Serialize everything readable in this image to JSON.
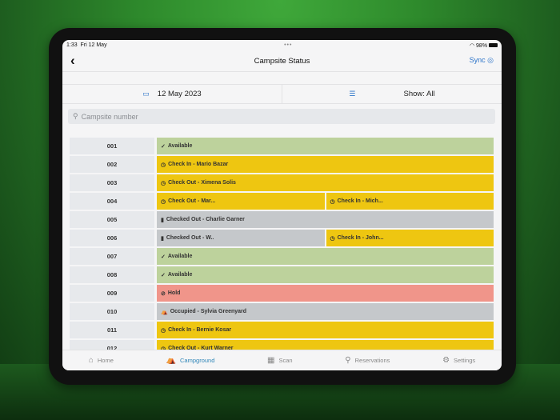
{
  "status_bar": {
    "time": "1:33",
    "date": "Fri 12 May",
    "battery": "98%"
  },
  "nav": {
    "title": "Campsite Status",
    "sync_label": "Sync"
  },
  "filters": {
    "date": "12 May 2023",
    "show": "Show: All"
  },
  "search": {
    "placeholder": "Campsite number"
  },
  "colors": {
    "available": "#bdd29c",
    "pending": "#eec611",
    "checked_out": "#c5c8cb",
    "hold": "#f0958a",
    "occupied": "#c5c8cb",
    "accent": "#2c74c9"
  },
  "sites": [
    {
      "number": "001",
      "cells": [
        {
          "status": "available",
          "icon": "check-icon",
          "label": "Available"
        }
      ]
    },
    {
      "number": "002",
      "cells": [
        {
          "status": "pending",
          "icon": "clock-icon",
          "label": "Check In - Mario Bazar"
        }
      ]
    },
    {
      "number": "003",
      "cells": [
        {
          "status": "pending",
          "icon": "clock-icon",
          "label": "Check Out - Ximena Solis"
        }
      ]
    },
    {
      "number": "004",
      "cells": [
        {
          "status": "pending",
          "icon": "clock-icon",
          "label": "Check Out - Mar..."
        },
        {
          "status": "pending",
          "icon": "clock-icon",
          "label": "Check In - Mich..."
        }
      ]
    },
    {
      "number": "005",
      "cells": [
        {
          "status": "checked_out",
          "icon": "door-icon",
          "label": "Checked Out - Charlie Garner"
        }
      ]
    },
    {
      "number": "006",
      "cells": [
        {
          "status": "checked_out",
          "icon": "door-icon",
          "label": "Checked Out - W.."
        },
        {
          "status": "pending",
          "icon": "clock-icon",
          "label": "Check In - John..."
        }
      ]
    },
    {
      "number": "007",
      "cells": [
        {
          "status": "available",
          "icon": "check-icon",
          "label": "Available"
        }
      ]
    },
    {
      "number": "008",
      "cells": [
        {
          "status": "available",
          "icon": "check-icon",
          "label": "Available"
        }
      ]
    },
    {
      "number": "009",
      "cells": [
        {
          "status": "hold",
          "icon": "prohibited-icon",
          "label": "Hold"
        }
      ]
    },
    {
      "number": "010",
      "cells": [
        {
          "status": "occupied",
          "icon": "tent-icon",
          "label": "Occupied - Sylvia Greenyard"
        }
      ]
    },
    {
      "number": "011",
      "cells": [
        {
          "status": "pending",
          "icon": "clock-icon",
          "label": "Check In - Bernie Kosar"
        }
      ]
    },
    {
      "number": "012",
      "cells": [
        {
          "status": "pending",
          "icon": "clock-icon",
          "label": "Check Out - Kurt Warner"
        }
      ]
    }
  ],
  "tabs": [
    {
      "label": "Home",
      "icon": "home-icon",
      "active": false
    },
    {
      "label": "Campground",
      "icon": "tent-icon",
      "active": true
    },
    {
      "label": "Scan",
      "icon": "qr-code-icon",
      "active": false
    },
    {
      "label": "Reservations",
      "icon": "search-icon",
      "active": false
    },
    {
      "label": "Settings",
      "icon": "gear-icon",
      "active": false
    }
  ]
}
